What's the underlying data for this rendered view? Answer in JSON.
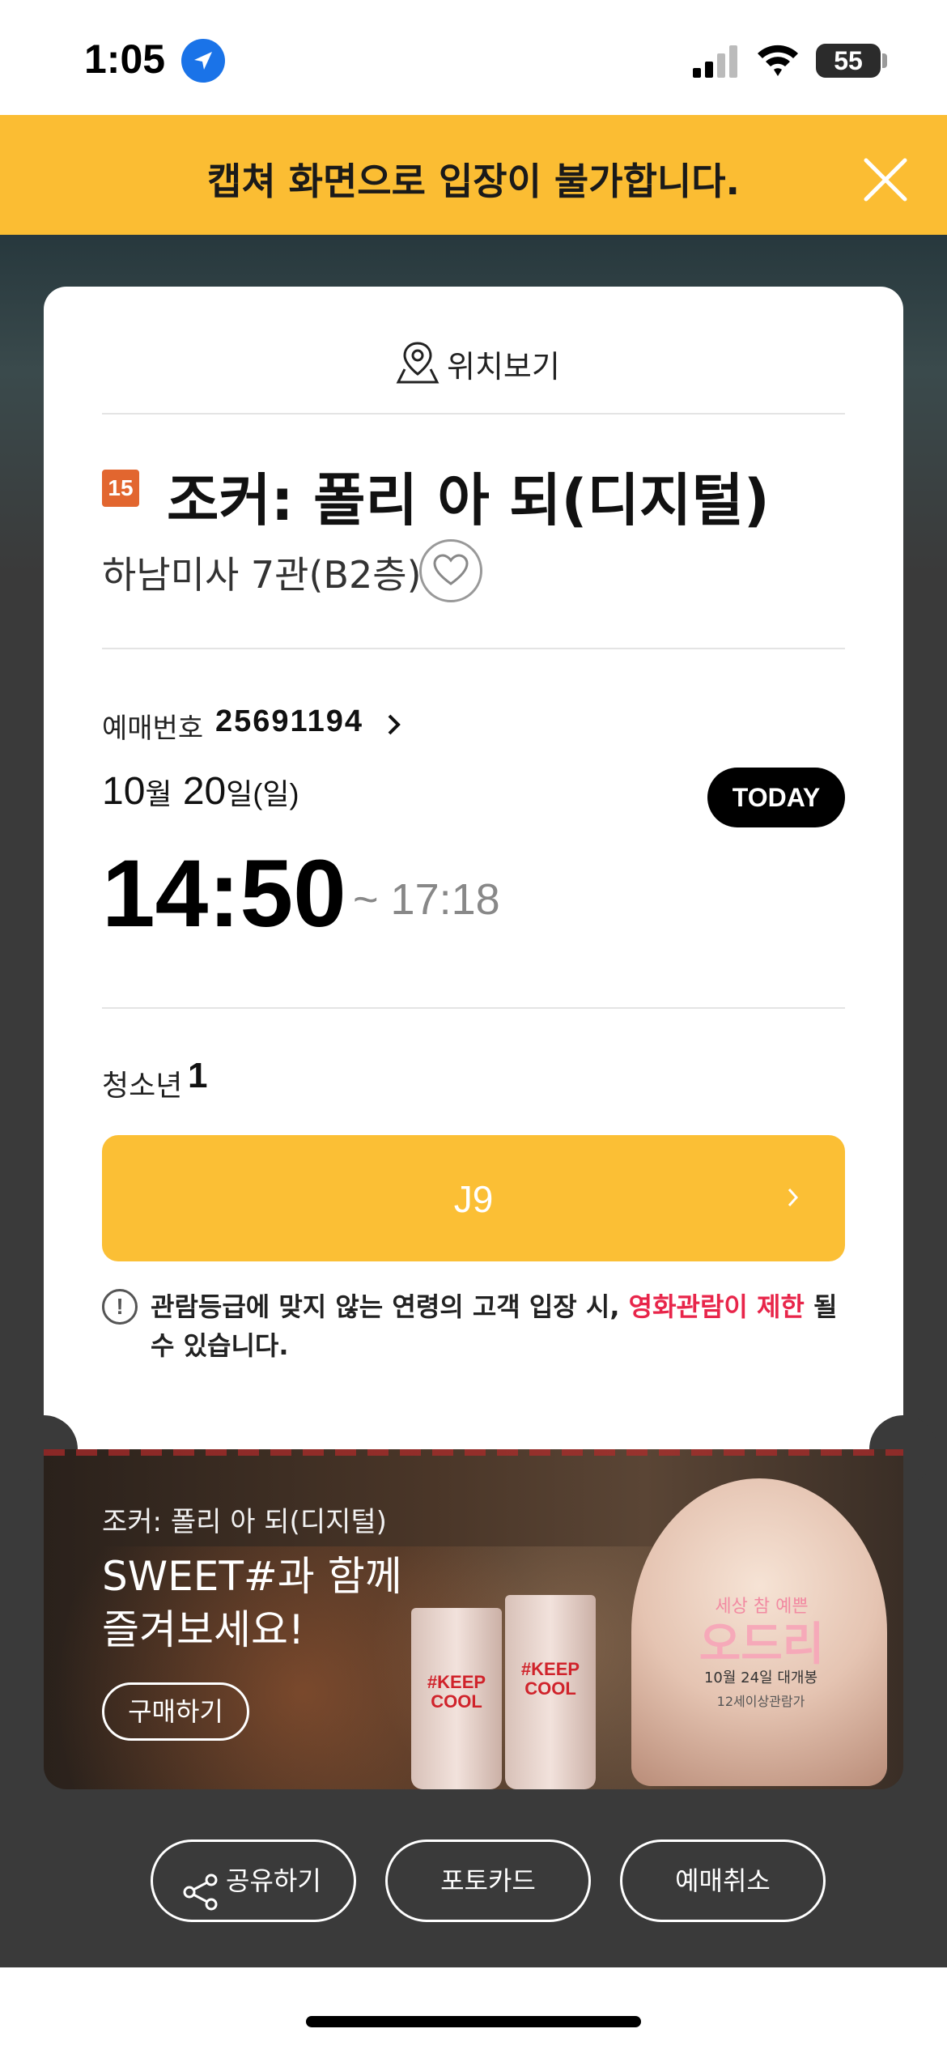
{
  "status_bar": {
    "time": "1:05",
    "battery": "55"
  },
  "banner": {
    "text": "캡쳐 화면으로 입장이 불가합니다.",
    "close_icon": "close-icon"
  },
  "ticket": {
    "location_label": "위치보기",
    "rating": "15",
    "movie_title": "조커: 폴리 아 되(디지털)",
    "theater": "하남미사 7관(B2층)",
    "reservation_label": "예매번호",
    "reservation_number": "25691194",
    "date": {
      "month": "10",
      "month_unit": "월",
      "day": "20",
      "day_unit": "일(일)"
    },
    "today_badge": "TODAY",
    "start_time": "14:50",
    "end_time": "~ 17:18",
    "audience_label": "청소년",
    "audience_count": "1",
    "seat": "J9",
    "notice_icon": "!",
    "notice_text": "관람등급에 맞지 않는 연령의 고객 입장 시, ",
    "notice_warning": "영화관람이 제한",
    "notice_text_end": "될 수 있습니다."
  },
  "ad": {
    "movie": "조커: 폴리 아 되(디지털)",
    "headline": "SWEET#과 함께 즐겨보세요!",
    "buy_label": "구매하기",
    "cup_text": "#KEEP COOL",
    "poster_sub": "세상 참 예쁜",
    "poster_title": "오드리",
    "poster_date": "10월 24일 대개봉",
    "poster_age": "12세이상관람가"
  },
  "actions": {
    "share": "공유하기",
    "photo_card": "포토카드",
    "cancel": "예매취소"
  },
  "colors": {
    "banner": "#fbbd33",
    "seat_button": "#fbbf35",
    "rating_badge": "#e2662f",
    "warning": "#e8254a"
  }
}
